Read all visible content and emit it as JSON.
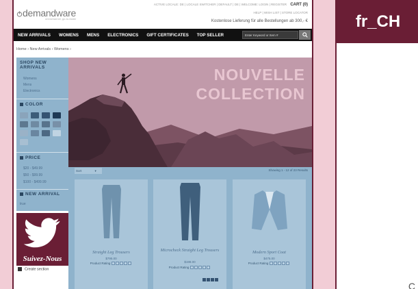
{
  "header": {
    "logo_text": "demandware",
    "logo_tagline": "omnichannel, go-to-faster",
    "util_links": "ACTIVE LOCALE: DE  |  LOCALE SWITCHER  |  DEFAULT  |  DE  |  WELCOME: LOGIN  |  REGISTER",
    "cart_label": "CART",
    "cart_count": "(0)",
    "help_links": "HELP  |  WISH LIST  |  STORE LOCATOR",
    "shipping_note": "Kostenlose Lieferung für alle Bestellungen ab 300,- €"
  },
  "nav": {
    "items": [
      {
        "label": "NEW ARRIVALS"
      },
      {
        "label": "WOMENS"
      },
      {
        "label": "MENS"
      },
      {
        "label": "ELECTRONICS"
      },
      {
        "label": "GIFT CERTIFICATES"
      },
      {
        "label": "TOP SELLER"
      }
    ],
    "search_placeholder": "Enter Keyword or Item #"
  },
  "breadcrumb": "Home  ›  New Arrivals  ›  Womens  ›",
  "sidebar": {
    "shop_heading": "SHOP NEW ARRIVALS",
    "categories": [
      "Womens",
      "Mens",
      "Electronics"
    ],
    "color_heading": "COLOR",
    "price_heading": "PRICE",
    "prices": [
      "$20 - $49.99",
      "$50 - $99.99",
      "$100 - $499.99"
    ],
    "arrival_heading": "NEW ARRIVAL",
    "arrival_value": "true",
    "promo_text": "Suivez-Nous",
    "create_section": "Create section",
    "swatch_colors": [
      "#8aa4bb",
      "#3c5c79",
      "#355372",
      "#1f3a56",
      "#5d7890",
      "#6f8aa2",
      "#58738c",
      "#7890a8",
      "#9ab2c7",
      "#6a86a0",
      "#4c6883",
      "#c0d4e3",
      "#a7bfd2"
    ]
  },
  "hero": {
    "line1": "NOUVELLE",
    "line2": "COLLECTION"
  },
  "products": {
    "sort_label": "Sort",
    "results": "Showing 1 - 12 of 23 Results",
    "items": [
      {
        "name": "Straight Leg Trousers",
        "price": "$795.00",
        "rating_label": "Product Rating"
      },
      {
        "name": "Microcheck Straight Leg Trousers",
        "price": "$198.00",
        "rating_label": "Product Rating"
      },
      {
        "name": "Modern Sport Coat",
        "price": "$475.00",
        "rating_label": "Product Rating"
      }
    ]
  },
  "locale_badge": "fr_CH",
  "colors": {
    "brand_wine": "#6a1e35",
    "overlay_pink": "#f2cdd6",
    "overlay_blue": "#8fb3cc"
  }
}
